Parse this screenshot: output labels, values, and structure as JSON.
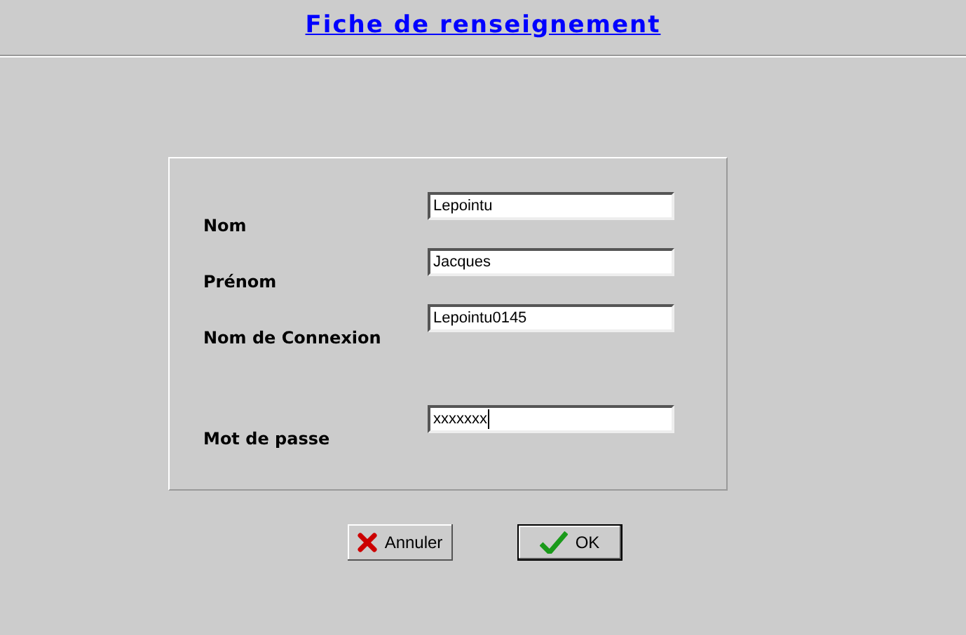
{
  "title": "Fiche de renseignement",
  "fields": [
    {
      "label": "Nom",
      "value": "Lepointu"
    },
    {
      "label": "Prénom",
      "value": "Jacques"
    },
    {
      "label": "Nom de Connexion",
      "value": "Lepointu0145"
    }
  ],
  "password": {
    "label": "Mot de passe",
    "value": "xxxxxxx",
    "focused": true
  },
  "buttons": [
    {
      "label": "Annuler",
      "kind": "cancel",
      "default": false
    },
    {
      "label": "OK",
      "kind": "ok",
      "default": true
    }
  ]
}
